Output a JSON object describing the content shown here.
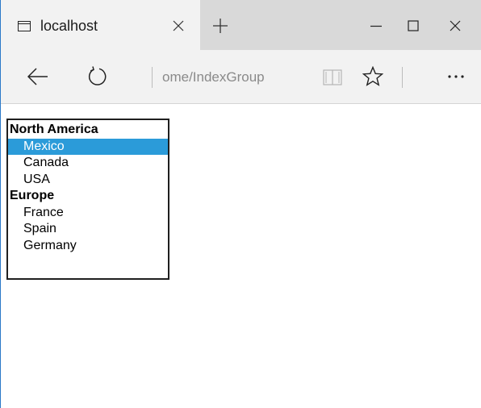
{
  "browser": {
    "tab": {
      "title": "localhost"
    },
    "address": {
      "text": "ome/IndexGroup"
    }
  },
  "listbox": {
    "groups": [
      {
        "label": "North America",
        "options": [
          "Mexico",
          "Canada",
          "USA"
        ]
      },
      {
        "label": "Europe",
        "options": [
          "France",
          "Spain",
          "Germany"
        ]
      }
    ],
    "selected": "Mexico",
    "selected_color": "#2b9bd9"
  },
  "colors": {
    "window_border": "#2b79c8",
    "tab_strip": "#d9d9d9",
    "toolbar": "#f2f2f2"
  }
}
